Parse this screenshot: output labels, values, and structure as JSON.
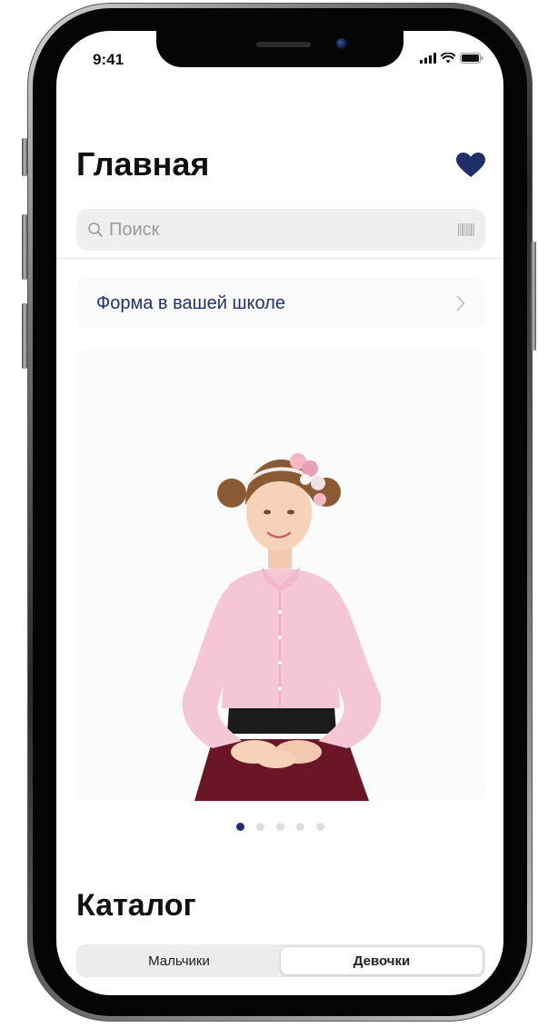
{
  "status_bar": {
    "time": "9:41"
  },
  "header": {
    "title": "Главная",
    "favorites_icon": "heart-icon",
    "accent_color": "#1f2f6a"
  },
  "search": {
    "placeholder": "Поиск",
    "left_icon": "search-icon",
    "right_icon": "barcode-icon"
  },
  "school_link": {
    "label": "Форма в вашей школе",
    "icon": "chevron-right-icon"
  },
  "banner": {
    "alt": "Девочка в розовой блузке и бордовой юбке",
    "pages": 5,
    "active_page": 1
  },
  "catalog": {
    "title": "Каталог",
    "segments": [
      {
        "label": "Мальчики",
        "selected": false
      },
      {
        "label": "Девочки",
        "selected": true
      }
    ]
  }
}
